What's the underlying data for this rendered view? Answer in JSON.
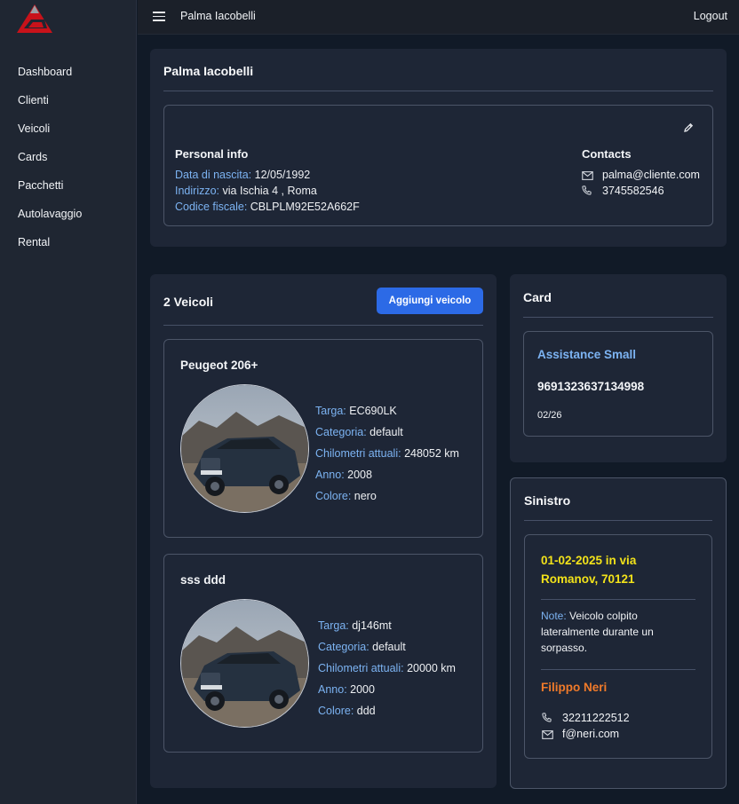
{
  "app": {
    "user_name": "Palma Iacobelli",
    "logout_label": "Logout"
  },
  "sidebar": {
    "items": [
      {
        "label": "Dashboard"
      },
      {
        "label": "Clienti"
      },
      {
        "label": "Veicoli"
      },
      {
        "label": "Cards"
      },
      {
        "label": "Pacchetti"
      },
      {
        "label": "Autolavaggio"
      },
      {
        "label": "Rental"
      }
    ]
  },
  "profile": {
    "title": "Palma Iacobelli",
    "personal_info_title": "Personal info",
    "birth_label": "Data di nascita:",
    "birth_value": "12/05/1992",
    "address_label": "Indirizzo:",
    "address_value": "via Ischia 4 , Roma",
    "fiscal_label": "Codice fiscale:",
    "fiscal_value": "CBLPLM92E52A662F",
    "contacts_title": "Contacts",
    "email": "palma@cliente.com",
    "phone": "3745582546"
  },
  "vehicles": {
    "title": "2 Veicoli",
    "add_button": "Aggiungi veicolo",
    "labels": {
      "plate": "Targa:",
      "category": "Categoria:",
      "km": "Chilometri attuali:",
      "year": "Anno:",
      "color": "Colore:"
    },
    "items": [
      {
        "name": "Peugeot 206+",
        "plate": "EC690LK",
        "category": "default",
        "km": "248052 km",
        "year": "2008",
        "color": "nero"
      },
      {
        "name": "sss ddd",
        "plate": "dj146mt",
        "category": "default",
        "km": "20000 km",
        "year": "2000",
        "color": "ddd"
      }
    ]
  },
  "card": {
    "title": "Card",
    "name": "Assistance Small",
    "number": "9691323637134998",
    "expiry": "02/26"
  },
  "claim": {
    "title": "Sinistro",
    "event_line1": "01-02-2025 in via",
    "event_line2": "Romanov, 70121",
    "note_label": "Note:",
    "note_line1": "Veicolo colpito",
    "note_line2": "lateralmente durante un",
    "note_line3": "sorpasso.",
    "contact_name": "Filippo Neri",
    "contact_phone": "32211222512",
    "contact_email": "f@neri.com"
  },
  "colors": {
    "accent_blue": "#2c6ae6",
    "label_blue": "#7cb3f2",
    "date_yellow": "#f2e21a",
    "name_orange": "#f07a2a",
    "logo_red": "#c8121a"
  }
}
